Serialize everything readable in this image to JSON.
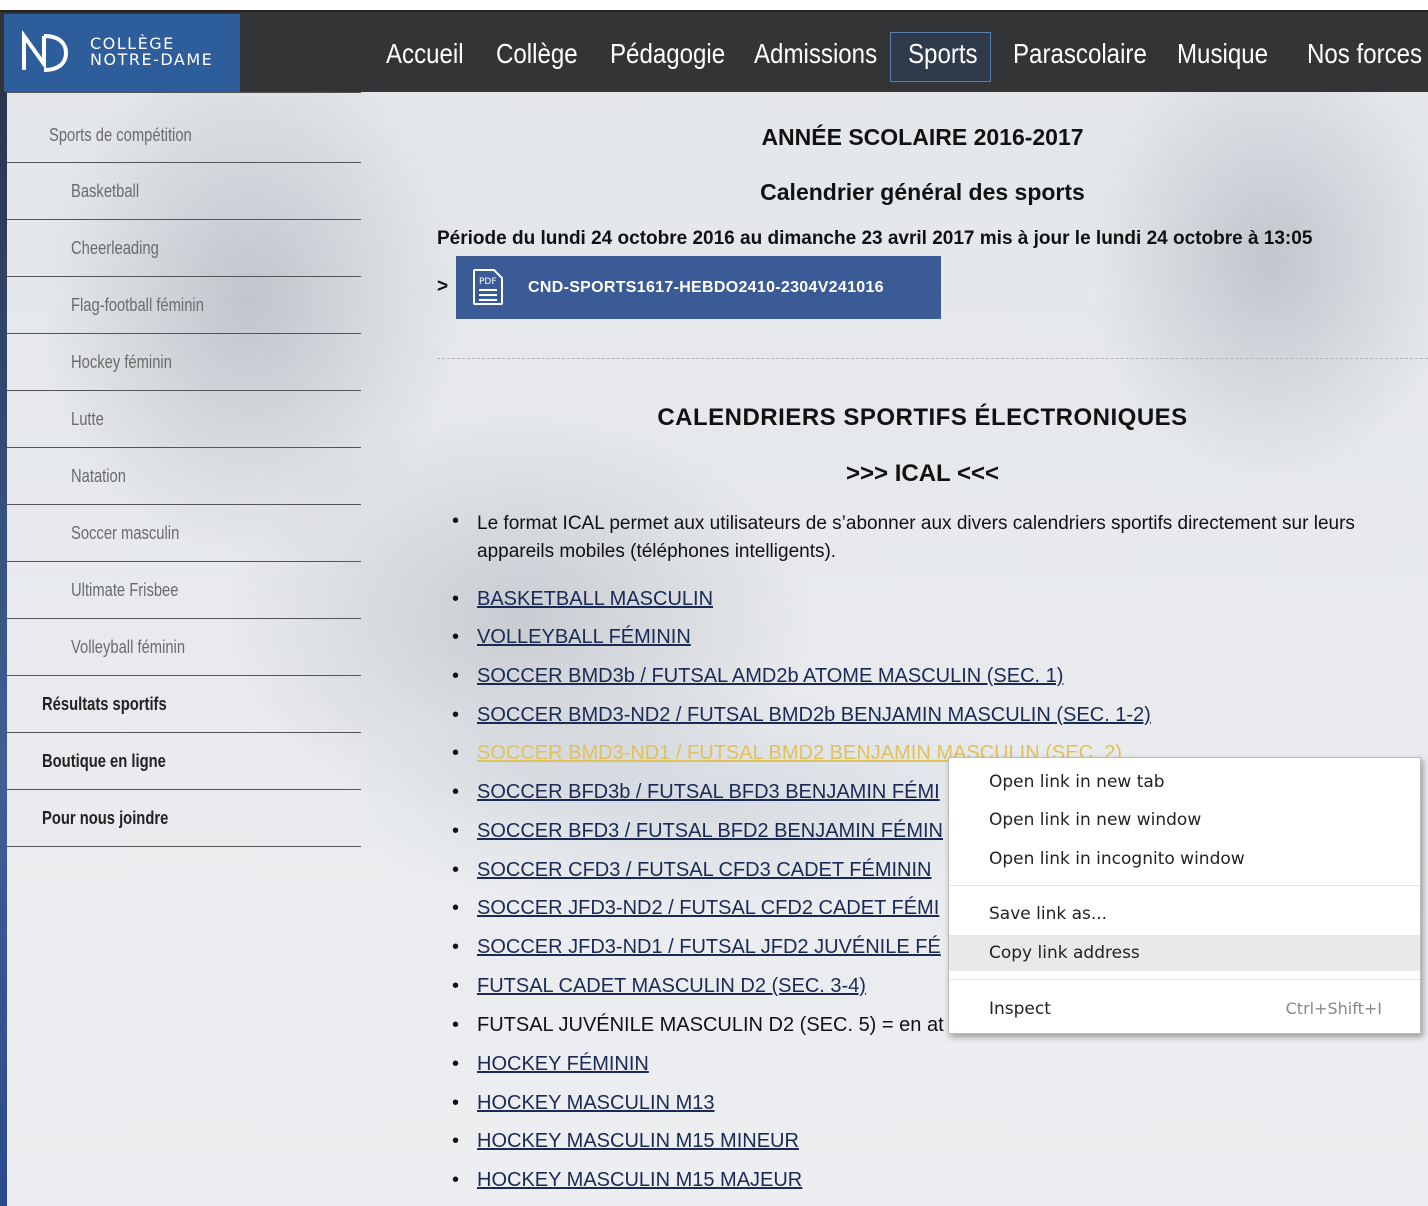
{
  "header": {
    "logo_line1": "COLLÈGE",
    "logo_line2": "NOTRE-DAME",
    "nav": [
      "Accueil",
      "Collège",
      "Pédagogie",
      "Admissions",
      "Sports",
      "Parascolaire",
      "Musique",
      "Nos forces"
    ],
    "active_nav": "Sports"
  },
  "sidebar": {
    "section": "Sports de compétition",
    "sub_items": [
      "Basketball",
      "Cheerleading",
      "Flag-football féminin",
      "Hockey féminin",
      "Lutte",
      "Natation",
      "Soccer masculin",
      "Ultimate Frisbee",
      "Volleyball féminin"
    ],
    "bold_items": [
      "Résultats sportifs",
      "Boutique en ligne",
      "Pour nous joindre"
    ]
  },
  "main": {
    "year_title": "ANNÉE SCOLAIRE 2016-2017",
    "calendar_title": "Calendrier général des sports",
    "period": "Période du lundi 24 octobre 2016 au dimanche 23 avril 2017 mis à jour le lundi 24 octobre à 13:05",
    "pdf_arrow": ">",
    "pdf_icon_text": "PDF",
    "pdf_label": "CND-SPORTS1617-HEBDO2410-2304V241016",
    "ecal_title": "CALENDRIERS SPORTIFS ÉLECTRONIQUES",
    "ical_title": ">>> ICAL <<<",
    "description": "Le format ICAL permet aux utilisateurs de s’abonner aux divers calendriers sportifs directement sur leurs appareils mobiles (téléphones intelligents).",
    "links": [
      "BASKETBALL MASCULIN",
      "VOLLEYBALL FÉMININ",
      "SOCCER BMD3b / FUTSAL AMD2b ATOME MASCULIN (SEC. 1)",
      "SOCCER BMD3-ND2 / FUTSAL BMD2b BENJAMIN MASCULIN (SEC. 1-2)",
      "SOCCER BMD3-ND1 / FUTSAL BMD2 BENJAMIN MASCULIN (SEC. 2)",
      "SOCCER BFD3b / FUTSAL BFD3 BENJAMIN FÉMI",
      "SOCCER BFD3 / FUTSAL BFD2 BENJAMIN FÉMIN",
      "SOCCER CFD3 / FUTSAL CFD3 CADET FÉMININ",
      "SOCCER JFD3-ND2 / FUTSAL CFD2 CADET FÉMI",
      "SOCCER JFD3-ND1 / FUTSAL JFD2 JUVÉNILE FÉ",
      "FUTSAL CADET MASCULIN D2 (SEC. 3-4)",
      "FUTSAL JUVÉNILE MASCULIN D2 (SEC. 5) = en at",
      "HOCKEY FÉMININ",
      "HOCKEY MASCULIN M13",
      "HOCKEY MASCULIN M15 MINEUR",
      "HOCKEY MASCULIN M15 MAJEUR"
    ]
  },
  "context_menu": {
    "items": [
      "Open link in new tab",
      "Open link in new window",
      "Open link in incognito window",
      "Save link as...",
      "Copy link address",
      "Inspect"
    ],
    "inspect_shortcut": "Ctrl+Shift+I",
    "highlighted": "Copy link address"
  }
}
